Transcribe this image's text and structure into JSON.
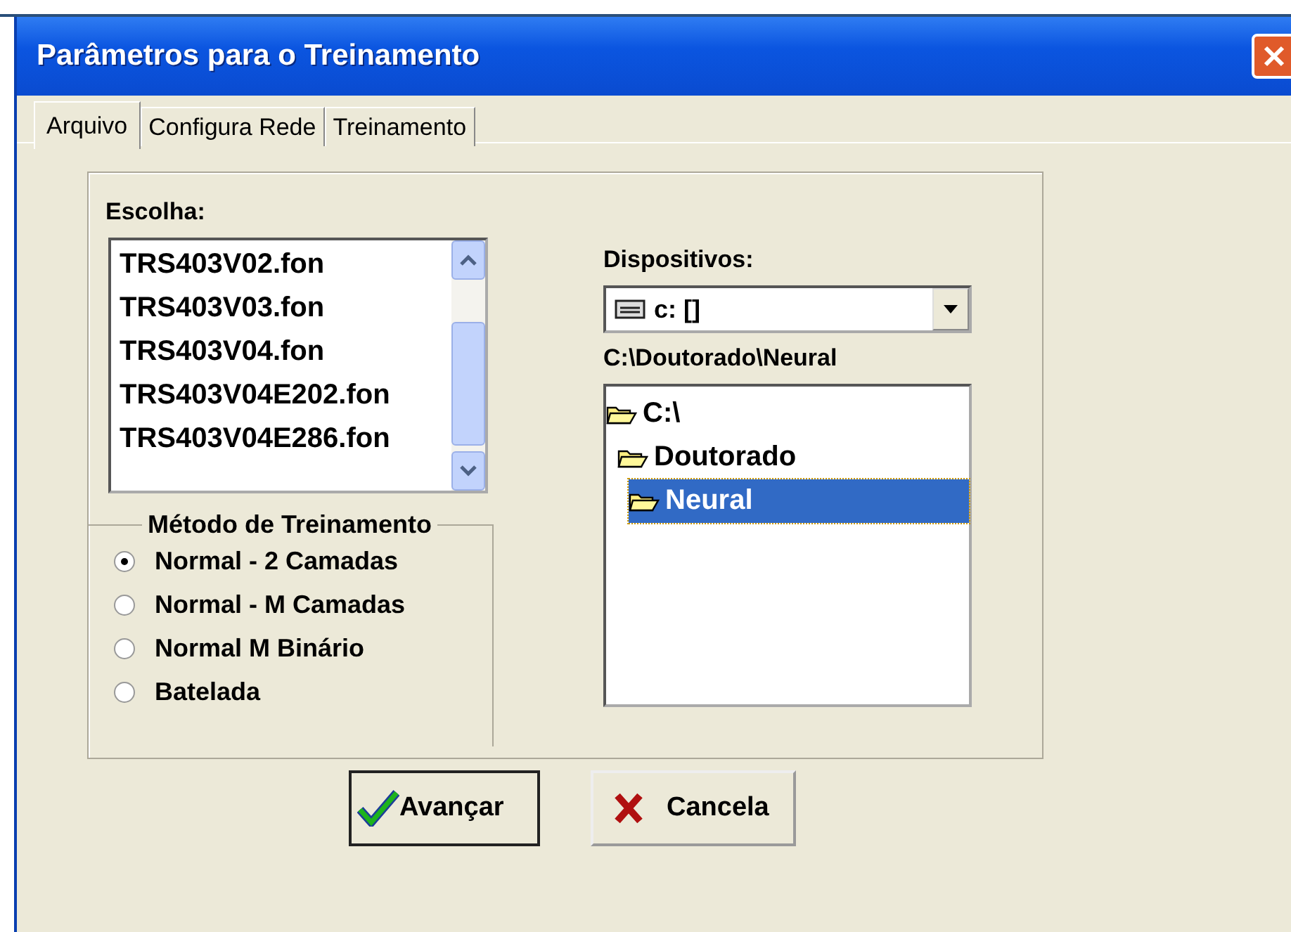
{
  "window": {
    "title": "Parâmetros para o Treinamento"
  },
  "tabs": [
    {
      "label": "Arquivo",
      "selected": true
    },
    {
      "label": "Configura Rede",
      "selected": false
    },
    {
      "label": "Treinamento",
      "selected": false
    }
  ],
  "file_list": {
    "label": "Escolha:",
    "items": [
      {
        "label": "TRS403V02.fon",
        "selected": false
      },
      {
        "label": "TRS403V03.fon",
        "selected": false
      },
      {
        "label": "TRS403V04.fon",
        "selected": false
      },
      {
        "label": "TRS403V04E202.fon",
        "selected": false
      },
      {
        "label": "TRS403V04E286.fon",
        "selected": false
      }
    ]
  },
  "training_method": {
    "title": "Método de Treinamento",
    "options": [
      {
        "label": "Normal - 2 Camadas",
        "selected": true
      },
      {
        "label": "Normal - M Camadas",
        "selected": false
      },
      {
        "label": "Normal M Binário",
        "selected": false
      },
      {
        "label": "Batelada",
        "selected": false
      }
    ]
  },
  "devices": {
    "label": "Dispositivos:",
    "value": "c: []"
  },
  "current_path": "C:\\Doutorado\\Neural",
  "folder_tree": [
    {
      "label": "C:\\",
      "selected": false,
      "children": [
        {
          "label": "Doutorado",
          "selected": false,
          "children": [
            {
              "label": "Neural",
              "selected": true
            }
          ]
        }
      ]
    }
  ],
  "buttons": [
    {
      "kind": "ok",
      "label": "Avançar"
    },
    {
      "kind": "cancel",
      "label": "Cancela"
    }
  ]
}
